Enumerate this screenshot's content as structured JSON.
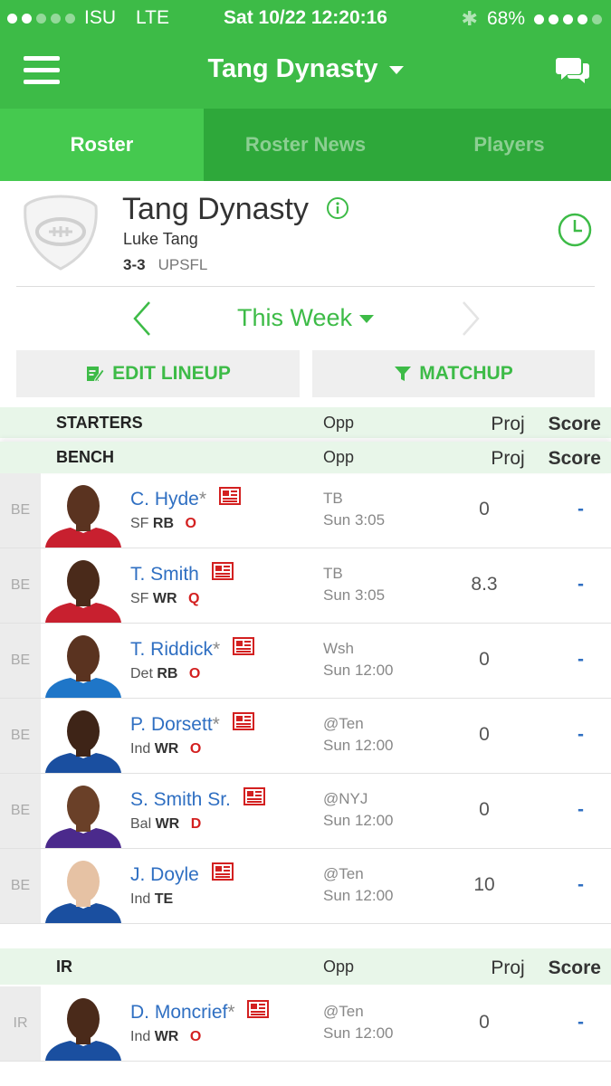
{
  "status_bar": {
    "carrier": "ISU",
    "network": "LTE",
    "datetime": "Sat 10/22 12:20:16",
    "battery": "68%"
  },
  "nav": {
    "title": "Tang Dynasty"
  },
  "tabs": [
    {
      "label": "Roster",
      "active": true
    },
    {
      "label": "Roster News",
      "active": false
    },
    {
      "label": "Players",
      "active": false
    }
  ],
  "team": {
    "name": "Tang Dynasty",
    "owner": "Luke Tang",
    "record": "3-3",
    "league": "UPSFL"
  },
  "week": {
    "label": "This Week"
  },
  "actions": {
    "edit_lineup": "EDIT LINEUP",
    "matchup": "MATCHUP"
  },
  "sections": {
    "starters": {
      "name": "STARTERS",
      "opp": "Opp",
      "proj": "Proj",
      "score": "Score"
    },
    "bench": {
      "name": "BENCH",
      "opp": "Opp",
      "proj": "Proj",
      "score": "Score"
    },
    "ir": {
      "name": "IR",
      "opp": "Opp",
      "proj": "Proj",
      "score": "Score"
    }
  },
  "bench_players": [
    {
      "slot": "BE",
      "name": "C. Hyde",
      "asterisk": "*",
      "team": "SF",
      "pos": "RB",
      "status": "O",
      "opp": "TB",
      "time": "Sun 3:05",
      "proj": "0",
      "score": "-",
      "jersey": "#c8202f",
      "skin": "#5a3320"
    },
    {
      "slot": "BE",
      "name": "T. Smith",
      "asterisk": "",
      "team": "SF",
      "pos": "WR",
      "status": "Q",
      "opp": "TB",
      "time": "Sun 3:05",
      "proj": "8.3",
      "score": "-",
      "jersey": "#c8202f",
      "skin": "#4a2a1a"
    },
    {
      "slot": "BE",
      "name": "T. Riddick",
      "asterisk": "*",
      "team": "Det",
      "pos": "RB",
      "status": "O",
      "opp": "Wsh",
      "time": "Sun 12:00",
      "proj": "0",
      "score": "-",
      "jersey": "#1f76c8",
      "skin": "#5a3320"
    },
    {
      "slot": "BE",
      "name": "P. Dorsett",
      "asterisk": "*",
      "team": "Ind",
      "pos": "WR",
      "status": "O",
      "opp": "@Ten",
      "time": "Sun 12:00",
      "proj": "0",
      "score": "-",
      "jersey": "#1a4fa0",
      "skin": "#3e2417"
    },
    {
      "slot": "BE",
      "name": "S. Smith Sr.",
      "asterisk": "",
      "team": "Bal",
      "pos": "WR",
      "status": "D",
      "opp": "@NYJ",
      "time": "Sun 12:00",
      "proj": "0",
      "score": "-",
      "jersey": "#4b2a8c",
      "skin": "#6a4028"
    },
    {
      "slot": "BE",
      "name": "J. Doyle",
      "asterisk": "",
      "team": "Ind",
      "pos": "TE",
      "status": "",
      "opp": "@Ten",
      "time": "Sun 12:00",
      "proj": "10",
      "score": "-",
      "jersey": "#1a4fa0",
      "skin": "#e6c2a4"
    }
  ],
  "ir_players": [
    {
      "slot": "IR",
      "name": "D. Moncrief",
      "asterisk": "*",
      "team": "Ind",
      "pos": "WR",
      "status": "O",
      "opp": "@Ten",
      "time": "Sun 12:00",
      "proj": "0",
      "score": "-",
      "jersey": "#1a4fa0",
      "skin": "#4a2a1a"
    }
  ],
  "colors": {
    "brand_green": "#3dbb47",
    "link_blue": "#2f6fc2",
    "status_red": "#d32020"
  }
}
